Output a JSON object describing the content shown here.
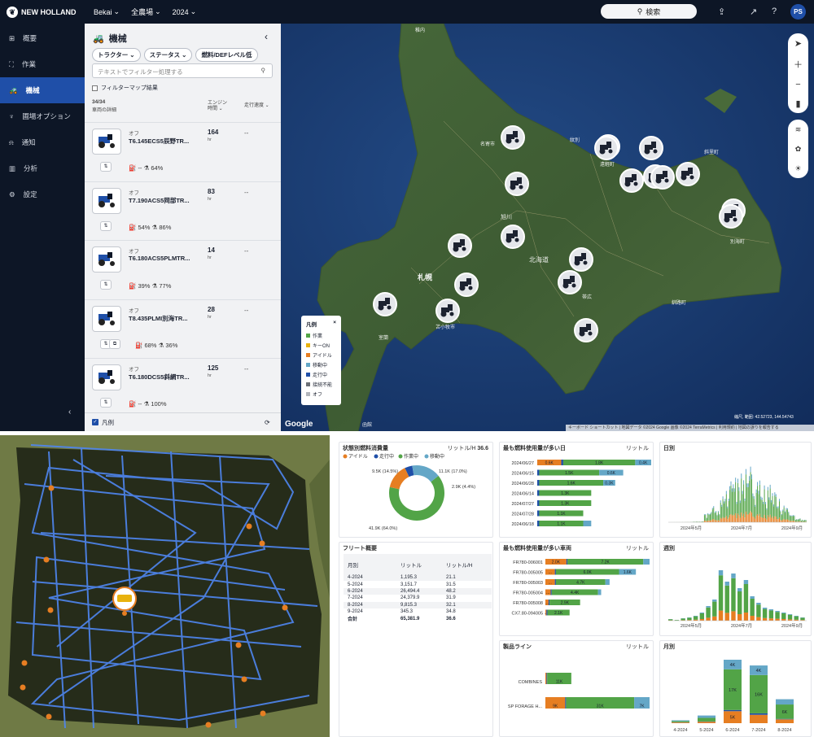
{
  "colors": {
    "work": "#52a447",
    "idle": "#e67e22",
    "travel": "#1f4fa8",
    "transit": "#64a7c7",
    "keyon": "#e8b20e",
    "unavailable": "#6b6f76",
    "off": "#b3b6bc",
    "nav": "#0d1626",
    "accent": "#1f4fa8"
  },
  "header": {
    "brand": "NEW HOLLAND",
    "org": "Bekai",
    "farm": "全農場",
    "year": "2024",
    "search": "検索",
    "initials": "PS",
    "icons": [
      "export-icon",
      "open-new-icon",
      "help-icon"
    ]
  },
  "nav": {
    "items": [
      {
        "label": "概要",
        "icon": "grid-icon"
      },
      {
        "label": "作業",
        "icon": "fields-icon"
      },
      {
        "label": "機械",
        "icon": "tractor-icon"
      },
      {
        "label": "圃場オプション",
        "icon": "shirt-icon"
      },
      {
        "label": "通知",
        "icon": "bell-icon"
      },
      {
        "label": "分析",
        "icon": "chart-icon"
      },
      {
        "label": "設定",
        "icon": "gear-icon"
      }
    ],
    "collapse": "‹"
  },
  "panel": {
    "title": "機械",
    "close": "‹",
    "filters": [
      "トラクター ⌄",
      "ステータス ⌄",
      "燃料/DEFレベル低"
    ],
    "filter_placeholder": "テキストでフィルター処理する",
    "filter_map_label": "フィルターマップ結果",
    "count": "34/34",
    "count_sub": "車両の詳細",
    "col_engine": "エンジン時間",
    "col_speed": "走行速度",
    "legend_label": "凡例",
    "machines": [
      {
        "status": "オフ",
        "name": "T6.145ECS5辰野TR...",
        "hours": "164",
        "unit": "hr",
        "speed": "--",
        "fuel": "--",
        "def": "64%"
      },
      {
        "status": "オフ",
        "name": "T7.190ACS5岡部TR...",
        "hours": "83",
        "unit": "hr",
        "speed": "--",
        "fuel": "54%",
        "def": "86%"
      },
      {
        "status": "オフ",
        "name": "T6.180ACS5PLMTR...",
        "hours": "14",
        "unit": "hr",
        "speed": "--",
        "fuel": "39%",
        "def": "77%"
      },
      {
        "status": "オフ",
        "name": "T8.435PLMI別海TR...",
        "hours": "28",
        "unit": "hr",
        "speed": "--",
        "fuel": "68%",
        "def": "36%"
      },
      {
        "status": "オフ",
        "name": "T6.180DCS5斜網TR...",
        "hours": "125",
        "unit": "hr",
        "speed": "--",
        "fuel": "--",
        "def": "100%"
      }
    ]
  },
  "map": {
    "labels": [
      "札幌",
      "旭川",
      "北海道",
      "別海町",
      "釧路町",
      "帯広",
      "稚内",
      "函館",
      "紋別",
      "遠軽町",
      "斜里町",
      "名寄市",
      "苫小牧市",
      "室蘭"
    ],
    "legend_title": "凡例",
    "legend_close": "×",
    "legend": [
      "作業",
      "キーON",
      "アイドル",
      "移動中",
      "走行中",
      "接続不能",
      "オフ"
    ],
    "coords": "縮尺, 範囲: 42.52723, 144.54743",
    "attribution": "キーボード ショートカット | 地図データ ©2024 Google 画像 ©2024 TerraMetrics | 利用規約 | 地図の誤りを報告する",
    "google": "Google",
    "controls": [
      "locate-icon",
      "zoom-in-icon",
      "zoom-out-icon",
      "map-type-icon",
      "layers-icon",
      "crop-icon",
      "weather-icon"
    ]
  },
  "fuel": {
    "title": "状態別燃料消費量",
    "unit": "リットル",
    "total": "36.6",
    "total_unit": "リットル/H",
    "legend": [
      "アイドル",
      "走行中",
      "作業中",
      "移動中"
    ],
    "labels": [
      "9.5K (14.5%)",
      "11.1K (17.0%)",
      "2.9K (4.4%)",
      "41.9K (64.0%)"
    ],
    "chart_data": {
      "type": "pie",
      "categories": [
        "作業中",
        "アイドル",
        "走行中",
        "移動中"
      ],
      "values": [
        41.9,
        9.5,
        2.9,
        11.1
      ],
      "unit": "K"
    }
  },
  "fleet": {
    "title": "フリート概要",
    "col1": "月別",
    "col2": "リットル",
    "col3": "リットル/H",
    "rows": [
      [
        "4-2024",
        "1,195.3",
        "21.1"
      ],
      [
        "5-2024",
        "3,151.7",
        "31.5"
      ],
      [
        "6-2024",
        "26,494.4",
        "48.2"
      ],
      [
        "7-2024",
        "24,379.9",
        "31.9"
      ],
      [
        "8-2024",
        "9,815.3",
        "32.1"
      ],
      [
        "9-2024",
        "345.3",
        "34.8"
      ]
    ],
    "total": [
      "合計",
      "65,381.9",
      "36.6"
    ]
  },
  "days": {
    "title": "最も燃料使用量が多い日",
    "unit": "リットル",
    "chart_data": {
      "type": "bar",
      "categories": [
        "2024/06/27",
        "2024/06/15",
        "2024/06/28",
        "2024/06/14",
        "2024/07/27",
        "2024/07/28",
        "2024/06/18"
      ],
      "series": [
        {
          "name": "アイドル",
          "values": [
            0.6,
            0,
            0,
            0,
            0,
            0,
            0
          ]
        },
        {
          "name": "走行中",
          "values": [
            0.05,
            0.05,
            0.05,
            0.05,
            0.05,
            0.05,
            0.05
          ]
        },
        {
          "name": "作業中",
          "values": [
            1.8,
            1.5,
            1.6,
            1.3,
            1.3,
            1.1,
            1.1
          ]
        },
        {
          "name": "移動中",
          "values": [
            0.4,
            0.6,
            0.3,
            0,
            0,
            0,
            0.2
          ]
        }
      ],
      "labels": [
        [
          "0.6K",
          "1.8K",
          "0.4K"
        ],
        [
          "",
          "1.5K",
          "0.6K"
        ],
        [
          "",
          "1.6K",
          "0.3K"
        ],
        [
          "",
          "1.3K",
          ""
        ],
        [
          "",
          "1.3K",
          ""
        ],
        [
          "",
          "1.1K",
          ""
        ],
        [
          "",
          "1.1K",
          ""
        ]
      ]
    }
  },
  "vehicles": {
    "title": "最も燃料使用量が多い車両",
    "unit": "リットル",
    "chart_data": {
      "type": "bar",
      "categories": [
        "FR780-006001",
        "FR780-005005",
        "FR780-005003",
        "FR780-005004",
        "FR780-005008",
        "CX7.80-094005"
      ],
      "series": [
        {
          "name": "アイドル",
          "values": [
            2.0,
            0.9,
            0.9,
            0.5,
            0.3,
            0.1
          ]
        },
        {
          "name": "走行中",
          "values": [
            0.1,
            0.1,
            0.1,
            0.1,
            0.1,
            0.1
          ]
        },
        {
          "name": "作業中",
          "values": [
            7.2,
            6.0,
            4.7,
            4.4,
            2.9,
            2.1
          ]
        },
        {
          "name": "移動中",
          "values": [
            0.6,
            1.6,
            0.4,
            0.3,
            0,
            0
          ]
        }
      ],
      "labels": [
        [
          "2.0K",
          "7.2K",
          ""
        ],
        [
          "...",
          "6.0K",
          "1.6K"
        ],
        [
          "...",
          "4.7K",
          ""
        ],
        [
          "...",
          "4.4K",
          ""
        ],
        [
          "...",
          "2.9K",
          ""
        ],
        [
          "...",
          "2.1K",
          ""
        ]
      ]
    }
  },
  "product": {
    "title": "製品ライン",
    "unit": "リットル",
    "chart_data": {
      "type": "bar",
      "categories": [
        "COMBINES",
        "SP FORAGE H..."
      ],
      "series": [
        {
          "name": "アイドル",
          "values": [
            0.5,
            9
          ]
        },
        {
          "name": "走行中",
          "values": [
            0.3,
            0.4
          ]
        },
        {
          "name": "作業中",
          "values": [
            11,
            31
          ]
        },
        {
          "name": "移動中",
          "values": [
            0,
            7
          ]
        }
      ],
      "labels": [
        [
          "",
          "11K",
          ""
        ],
        [
          "9K",
          "31K",
          "7K"
        ]
      ]
    }
  },
  "daily": {
    "title": "日別",
    "chart_data": {
      "type": "bar",
      "x_ticks": [
        "2024年5月",
        "2024年7月",
        "2024年9月"
      ]
    }
  },
  "weekly": {
    "title": "週別",
    "chart_data": {
      "type": "bar",
      "x_ticks": [
        "2024年5月",
        "2024年7月",
        "2024年9月"
      ]
    }
  },
  "monthly": {
    "title": "月別",
    "chart_data": {
      "type": "bar",
      "categories": [
        "4-2024",
        "5-2024",
        "6-2024",
        "7-2024",
        "8-2024"
      ],
      "series": [
        {
          "name": "アイドル",
          "values": [
            0.3,
            0.6,
            5,
            3.5,
            1.6
          ]
        },
        {
          "name": "走行中",
          "values": [
            0.1,
            0.1,
            0.5,
            0.6,
            0.2
          ]
        },
        {
          "name": "作業中",
          "values": [
            0.5,
            1.5,
            17,
            16,
            6
          ]
        },
        {
          "name": "移動中",
          "values": [
            0.3,
            1,
            4,
            4,
            2.2
          ]
        }
      ],
      "labels": [
        [
          "",
          "",
          ""
        ],
        [
          "",
          "",
          ""
        ],
        [
          "5K",
          "17K",
          "4K"
        ],
        [
          "",
          "16K",
          "4K"
        ],
        [
          "",
          "6K",
          ""
        ]
      ]
    }
  }
}
